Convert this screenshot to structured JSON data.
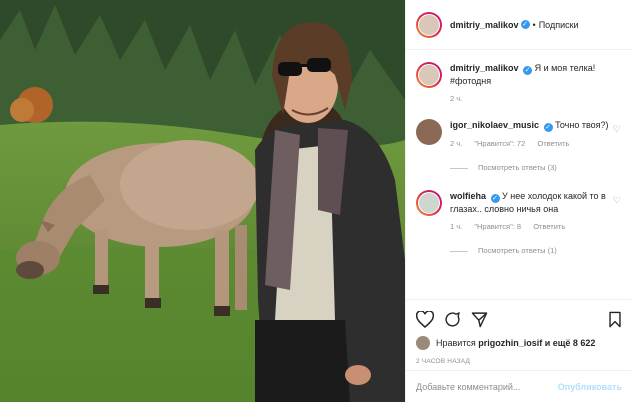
{
  "post": {
    "author": "dmitriy_malikov",
    "follow_label": "Подписки",
    "dot": "•",
    "caption": "Я и моя телка! #фотодня",
    "caption_time": "2 ч."
  },
  "comments": [
    {
      "user": "igor_nikolaev_music",
      "text": "Точно твоя?)",
      "time": "2 ч.",
      "likes": "\"Нравится\": 72",
      "reply": "Ответить",
      "view_replies": "Посмотреть ответы (3)"
    },
    {
      "user": "wolfieha",
      "text": "У нее холодок какой то в глазах.. словно ничья она",
      "time": "1 ч.",
      "likes": "\"Нравится\": 8",
      "reply": "Ответить",
      "view_replies": "Посмотреть ответы (1)"
    }
  ],
  "likes": {
    "prefix": "Нравится",
    "user": "prigozhin_iosif",
    "suffix": "и ещё 8 622"
  },
  "timestamp": "2 ЧАСОВ НАЗАД",
  "comment_box": {
    "placeholder": "Добавьте комментарий...",
    "publish_label": "Опубликовать"
  },
  "colors": {
    "link_blue": "#003569",
    "verified_blue": "#3897f0",
    "muted": "#8e8e8e"
  }
}
